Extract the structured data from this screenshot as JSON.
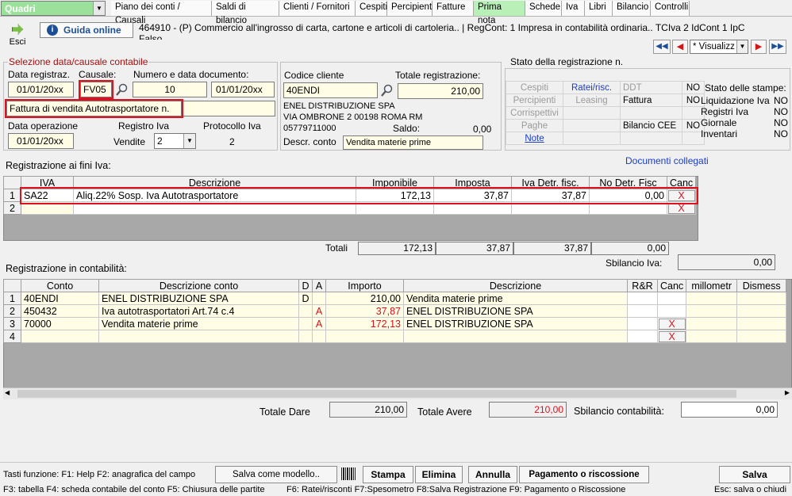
{
  "menu": {
    "quadri": "Quadri",
    "tabs": [
      "Piano dei conti / Causali",
      "Saldi di bilancio",
      "Clienti / Fornitori",
      "Cespiti",
      "Percipienti",
      "Fatture",
      "Prima nota",
      "Schede",
      "Iva",
      "Libri",
      "Bilancio",
      "Controlli"
    ],
    "active_tab": "Prima nota"
  },
  "toolbar": {
    "esci": "Esci",
    "guida": "Guida online",
    "company": "464910 - (P) Commercio all'ingrosso di carta, cartone e articoli di cartoleria.. | RegCont: 1 Impresa  in contabilità ordinaria..  TCIva 2 IdCont 1 IpC",
    "company_line2": "Falso",
    "view_select": "* Visualizz"
  },
  "selection": {
    "legend": "Selezione data/causale contabile",
    "data_reg_label": "Data registraz.",
    "data_reg": "01/01/20",
    "causale_label": "Causale:",
    "causale": "FV05",
    "numdoc_label": "Numero e data documento:",
    "numdoc": "10",
    "datadoc": "01/01/20",
    "causale_descr": "Fattura di vendita Autotrasportatore n.",
    "data_op_label": "Data operazione",
    "data_op": "01/01/20",
    "registro_label": "Registro Iva",
    "registro_type": "Vendite",
    "registro_num": "2",
    "protocollo_label": "Protocollo Iva",
    "protocollo": "2",
    "xx": "xx"
  },
  "client": {
    "code_label": "Codice cliente",
    "code": "40ENDI",
    "totale_label": "Totale registrazione:",
    "totale": "210,00",
    "name": "ENEL DISTRIBUZIONE SPA",
    "address": "VIA OMBRONE 2 00198 ROMA RM",
    "phone": "05779711000",
    "saldo_label": "Saldo:",
    "saldo": "0,00",
    "descr_conto_label": "Descr. conto",
    "descr_conto": "Vendita materie prime"
  },
  "status": {
    "title": "Stato della registrazione n.",
    "cells": [
      [
        "Cespiti",
        "Ratei/risc.",
        "DDT",
        "NO"
      ],
      [
        "Percipienti",
        "Leasing",
        "Fattura",
        "NO"
      ],
      [
        "Corrispettivi",
        "",
        "",
        ""
      ],
      [
        "Paghe",
        "",
        "Bilancio CEE",
        "NO"
      ],
      [
        "Note",
        "",
        "",
        ""
      ]
    ],
    "stampe_title": "Stato delle stampe:",
    "stampe": [
      [
        "Liquidazione Iva",
        "NO"
      ],
      [
        "Registri Iva",
        "NO"
      ],
      [
        "Giornale",
        "NO"
      ],
      [
        "Inventari",
        "NO"
      ]
    ],
    "documenti_collegati": "Documenti collegati"
  },
  "iva": {
    "title": "Registrazione ai fini Iva:",
    "headers": [
      "IVA",
      "Descrizione",
      "Imponibile",
      "Imposta",
      "Iva Detr. fisc.",
      "No Detr. Fisc",
      "Canc"
    ],
    "rows": [
      {
        "n": "1",
        "iva": "SA22",
        "descr": "Aliq.22% Sosp. Iva Autotrasportatore",
        "imponibile": "172,13",
        "imposta": "37,87",
        "detr": "37,87",
        "nodetr": "0,00",
        "canc": "X"
      },
      {
        "n": "2",
        "iva": "",
        "descr": "",
        "imponibile": "",
        "imposta": "",
        "detr": "",
        "nodetr": "",
        "canc": "X"
      }
    ],
    "totali_label": "Totali",
    "tot_imponibile": "172,13",
    "tot_imposta": "37,87",
    "tot_detr": "37,87",
    "tot_nodetr": "0,00",
    "sbilancio_label": "Sbilancio Iva:",
    "sbilancio": "0,00"
  },
  "conta": {
    "title": "Registrazione in contabilità:",
    "headers": [
      "Conto",
      "Descrizione conto",
      "D",
      "A",
      "Importo",
      "Descrizione",
      "R&R",
      "Canc",
      "millometr",
      "Dismess"
    ],
    "rows": [
      {
        "n": "1",
        "conto": "40ENDI",
        "descr": "ENEL DISTRIBUZIONE SPA",
        "d": "D",
        "a": "",
        "importo": "210,00",
        "descrizione": "Vendita materie prime",
        "canc": ""
      },
      {
        "n": "2",
        "conto": "450432",
        "descr": "Iva autotrasportatori Art.74 c.4",
        "d": "",
        "a": "A",
        "importo": "37,87",
        "descrizione": "ENEL DISTRIBUZIONE SPA",
        "canc": ""
      },
      {
        "n": "3",
        "conto": "70000",
        "descr": "Vendita materie prime",
        "d": "",
        "a": "A",
        "importo": "172,13",
        "descrizione": "ENEL DISTRIBUZIONE SPA",
        "canc": "X"
      },
      {
        "n": "4",
        "conto": "",
        "descr": "",
        "d": "",
        "a": "",
        "importo": "",
        "descrizione": "",
        "canc": "X"
      }
    ],
    "totale_dare_label": "Totale Dare",
    "totale_dare": "210,00",
    "totale_avere_label": "Totale Avere",
    "totale_avere": "210,00",
    "sbilancio_label": "Sbilancio contabilità:",
    "sbilancio": "0,00"
  },
  "footer": {
    "keys1": "Tasti funzione:  F1: Help   F2: anagrafica del campo",
    "keys2": "Esc: salva o chiudi",
    "keys3": "F3: tabella    F4: scheda contabile del conto   F5: Chiusura delle partite",
    "keys4": "F6: Ratei/risconti   F7:Spesometro   F8:Salva Registrazione     F9: Pagamento o Riscossione",
    "salva_modello": "Salva come modello..",
    "stampa": "Stampa",
    "elimina": "Elimina",
    "annulla": "Annulla",
    "pagamento": "Pagamento o riscossione",
    "salva": "Salva"
  },
  "colors": {
    "red": "#e0101c",
    "yellow_field": "#fffde6",
    "active_tab": "#b8f0b8",
    "link_blue": "#1a3cc8"
  }
}
